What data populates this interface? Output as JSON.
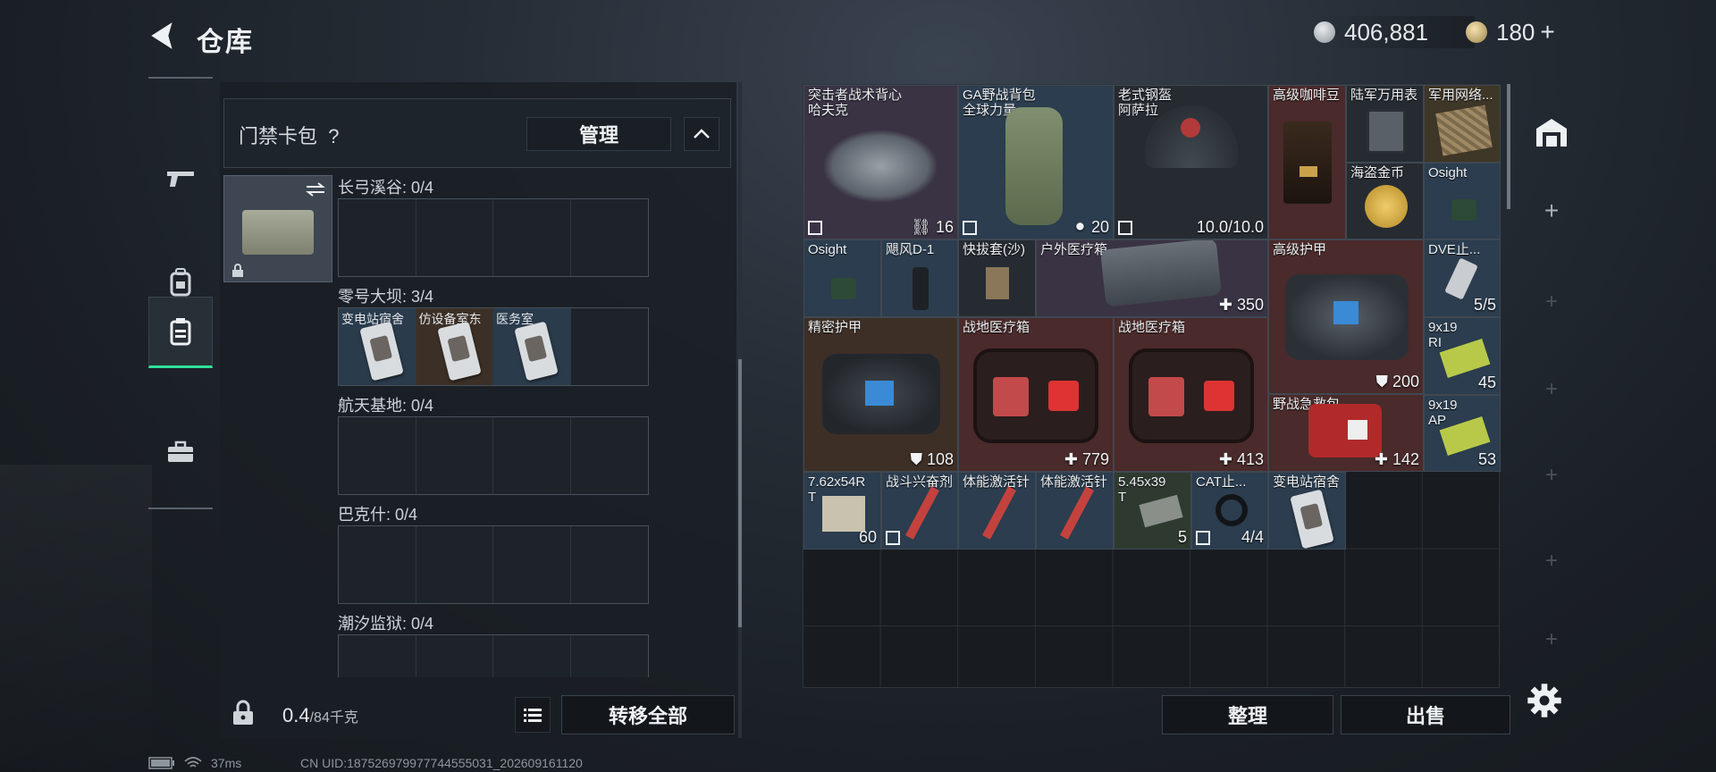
{
  "header": {
    "title": "仓库",
    "currency1": "406,881",
    "currency2": "180"
  },
  "colors": {
    "accent": "#2fe09a",
    "panel": "#1f252c",
    "item_red": "#4a2a2a",
    "item_blue": "#2b3d4e"
  },
  "left_nav": {
    "items": [
      "gun-icon",
      "backpack-icon",
      "card-holder-icon",
      "toolbox-icon"
    ],
    "active": "card-holder-icon"
  },
  "card_pack": {
    "title": "门禁卡包",
    "help": "?",
    "manage_label": "管理",
    "zones": [
      {
        "label": "长弓溪谷: 0/4",
        "cards": []
      },
      {
        "label": "零号大坝: 3/4",
        "cards": [
          "变电站宿舍",
          "仿设备室东",
          "医务室"
        ]
      },
      {
        "label": "航天基地: 0/4",
        "cards": []
      },
      {
        "label": "巴克什: 0/4",
        "cards": []
      },
      {
        "label": "潮汐监狱: 0/4",
        "cards": []
      }
    ]
  },
  "bottom": {
    "weight": "0.4",
    "weight_cap": "/84千克",
    "transfer_all": "转移全部",
    "sort": "整理",
    "sell": "出售"
  },
  "status": {
    "ping": "37ms",
    "uid": "CN UID:187526979977744555031_202609161120"
  },
  "stash_items": [
    {
      "name": "突击者战术背心\n哈夫克",
      "value": "16"
    },
    {
      "name": "GA野战背包\n全球力量",
      "value": "20"
    },
    {
      "name": "老式钢盔\n阿萨拉",
      "value": "10.0/10.0"
    },
    {
      "name": "高级咖啡豆",
      "value": ""
    },
    {
      "name": "陆军万用表",
      "value": ""
    },
    {
      "name": "军用网络...",
      "value": ""
    },
    {
      "name": "海盗金币",
      "value": ""
    },
    {
      "name": "Osight",
      "value": ""
    },
    {
      "name": "Osight",
      "value": ""
    },
    {
      "name": "飓风D-1",
      "value": ""
    },
    {
      "name": "快拔套(沙)",
      "value": ""
    },
    {
      "name": "户外医疗箱",
      "value": "350"
    },
    {
      "name": "高级护甲",
      "value": "200"
    },
    {
      "name": "DVE止...",
      "value": "5/5"
    },
    {
      "name": "精密护甲",
      "value": "108"
    },
    {
      "name": "战地医疗箱",
      "value": "779"
    },
    {
      "name": "战地医疗箱",
      "value": "413"
    },
    {
      "name": "9x19\nRI",
      "value": "45"
    },
    {
      "name": "野战急救包",
      "value": "142"
    },
    {
      "name": "9x19\nAP",
      "value": "53"
    },
    {
      "name": "7.62x54R\nT",
      "value": "60"
    },
    {
      "name": "战斗兴奋剂",
      "value": ""
    },
    {
      "name": "体能激活针",
      "value": ""
    },
    {
      "name": "体能激活针",
      "value": ""
    },
    {
      "name": "5.45x39\nT",
      "value": "5"
    },
    {
      "name": "CAT止...",
      "value": "4/4"
    },
    {
      "name": "变电站宿舍",
      "value": ""
    }
  ]
}
